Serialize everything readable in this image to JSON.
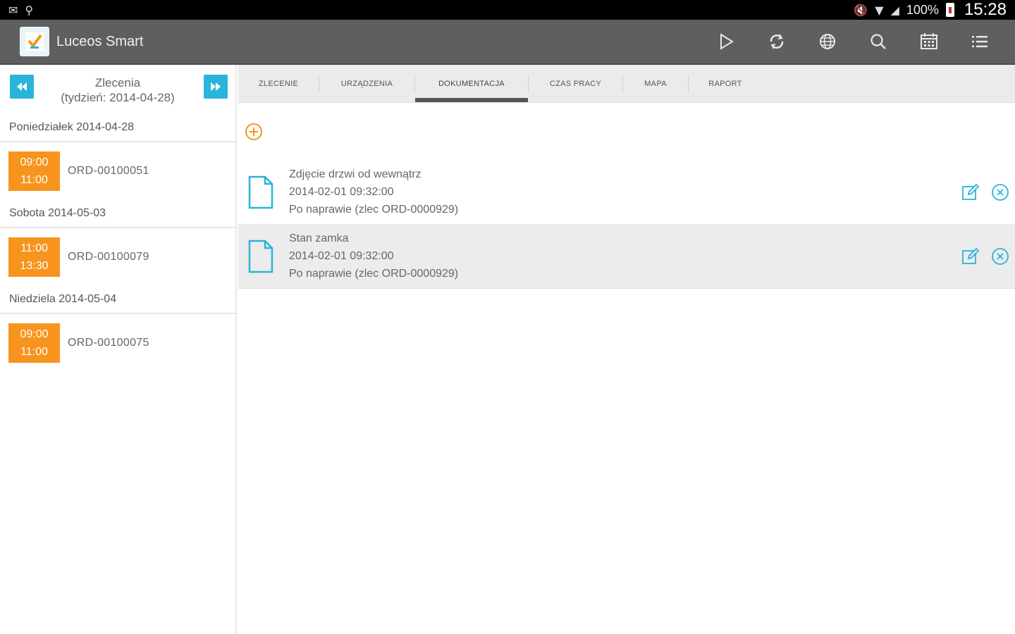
{
  "statusbar": {
    "battery": "100%",
    "clock": "15:28"
  },
  "app": {
    "title": "Luceos Smart"
  },
  "actionbar": {
    "icons": [
      "play-icon",
      "sync-icon",
      "globe-icon",
      "search-icon",
      "calendar-icon",
      "list-icon"
    ]
  },
  "sidebar": {
    "week_title": "Zlecenia",
    "week_subtitle": "(tydzień: 2014-04-28)",
    "days": [
      {
        "label": "Poniedziałek 2014-04-28",
        "orders": [
          {
            "start": "09:00",
            "end": "11:00",
            "id": "ORD-00100051"
          }
        ]
      },
      {
        "label": "Sobota 2014-05-03",
        "orders": [
          {
            "start": "11:00",
            "end": "13:30",
            "id": "ORD-00100079"
          }
        ]
      },
      {
        "label": "Niedziela 2014-05-04",
        "orders": [
          {
            "start": "09:00",
            "end": "11:00",
            "id": "ORD-00100075"
          }
        ]
      }
    ]
  },
  "tabs": [
    {
      "label": "ZLECENIE",
      "active": false
    },
    {
      "label": "URZĄDZENIA",
      "active": false
    },
    {
      "label": "DOKUMENTACJA",
      "active": true
    },
    {
      "label": "CZAS PRACY",
      "active": false
    },
    {
      "label": "MAPA",
      "active": false
    },
    {
      "label": "RAPORT",
      "active": false
    }
  ],
  "documents": [
    {
      "title": "Zdjęcie drzwi od wewnątrz",
      "date": "2014-02-01 09:32:00",
      "note": "Po naprawie (zlec ORD-0000929)"
    },
    {
      "title": "Stan zamka",
      "date": "2014-02-01 09:32:00",
      "note": "Po naprawie (zlec ORD-0000929)"
    }
  ],
  "colors": {
    "accent_blue": "#2ab4d9",
    "order_orange": "#f7941d",
    "actionbar": "#5f5f5f"
  }
}
